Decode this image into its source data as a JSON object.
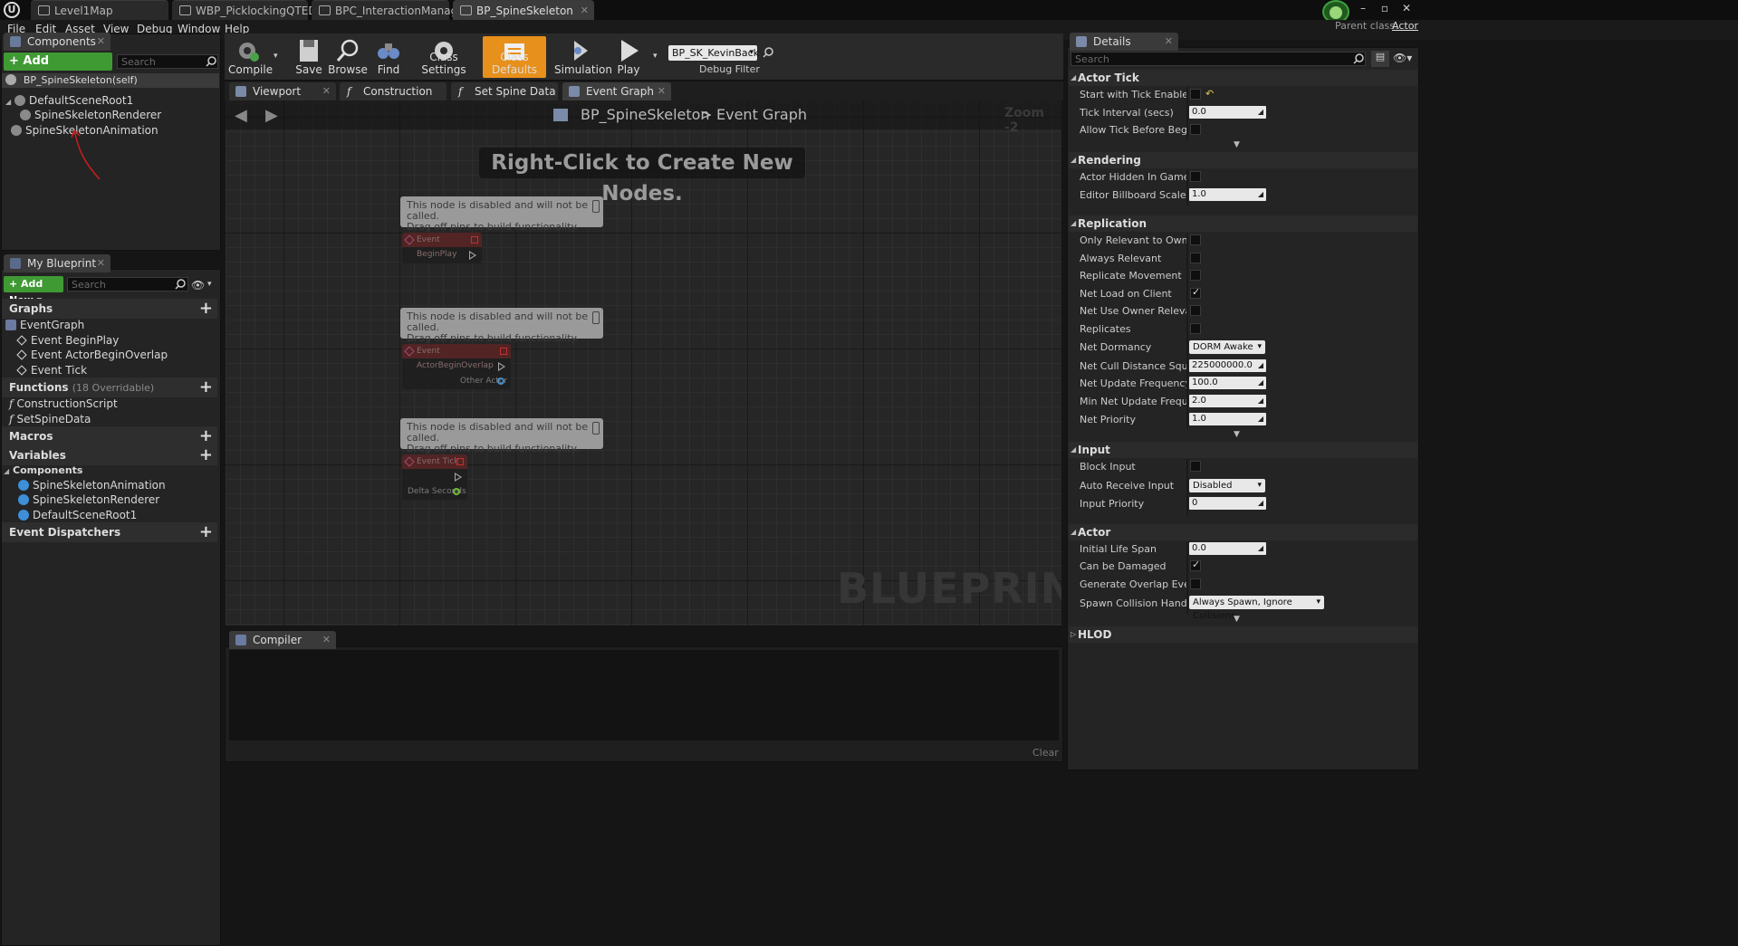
{
  "title_tabs": [
    "Level1Map",
    "WBP_PicklockingQTEDEV",
    "BPC_InteractionManager_",
    "BP_SpineSkeleton"
  ],
  "window_buttons": [
    "–",
    "▫",
    "✕"
  ],
  "parent_class": {
    "label": "Parent class:",
    "value": "Actor"
  },
  "menu": [
    "File",
    "Edit",
    "Asset",
    "View",
    "Debug",
    "Window",
    "Help"
  ],
  "components_panel": {
    "tab": "Components",
    "add_button": "+ Add Component ▾",
    "search_placeholder": "Search",
    "self_label": "BP_SpineSkeleton(self)",
    "tree": [
      "DefaultSceneRoot1",
      "SpineSkeletonRenderer",
      "SpineSkeletonAnimation"
    ]
  },
  "my_blueprint": {
    "tab": "My Blueprint",
    "add_button": "+ Add New ▾",
    "search_placeholder": "Search",
    "sections": {
      "graphs": "Graphs",
      "functions": "Functions",
      "functions_sub": "(18 Overridable)",
      "macros": "Macros",
      "variables": "Variables",
      "event_dispatchers": "Event Dispatchers"
    },
    "graph_items": [
      "EventGraph",
      "Event BeginPlay",
      "Event ActorBeginOverlap",
      "Event Tick"
    ],
    "function_items": [
      "ConstructionScript",
      "SetSpineData"
    ],
    "components_header": "Components",
    "component_vars": [
      "SpineSkeletonAnimation",
      "SpineSkeletonRenderer",
      "DefaultSceneRoot1"
    ]
  },
  "toolbar": {
    "compile": "Compile",
    "save": "Save",
    "browse": "Browse",
    "find": "Find",
    "class_settings": "Class Settings",
    "class_defaults": "Class Defaults",
    "simulation": "Simulation",
    "play": "Play",
    "debug_object": "BP_SK_KevinBack",
    "debug_filter": "Debug Filter"
  },
  "editor_tabs": [
    "Viewport",
    "Construction Scrip",
    "Set Spine Data",
    "Event Graph"
  ],
  "graph": {
    "breadcrumb_bp": "BP_SpineSkeleton",
    "breadcrumb_sep": ">",
    "breadcrumb_graph": "Event Graph",
    "zoom": "Zoom -2",
    "hint": "Right-Click to Create New Nodes.",
    "watermark": "BLUEPRINT",
    "disabled_line1": "This node is disabled and will not be called.",
    "disabled_line2": "Drag off pins to build functionality.",
    "nodes": [
      {
        "title": "Event BeginPlay"
      },
      {
        "title": "Event ActorBeginOverlap",
        "pin": "Other Actor"
      },
      {
        "title": "Event Tick",
        "pin": "Delta Seconds"
      }
    ]
  },
  "compiler": {
    "tab": "Compiler Results",
    "clear": "Clear"
  },
  "details": {
    "tab": "Details",
    "search_placeholder": "Search",
    "sections": {
      "actor_tick": "Actor Tick",
      "rendering": "Rendering",
      "replication": "Replication",
      "input": "Input",
      "actor": "Actor",
      "hlod": "HLOD"
    },
    "actor_tick": {
      "start_with_tick": "Start with Tick Enabled",
      "tick_interval": "Tick Interval (secs)",
      "tick_interval_value": "0.0",
      "allow_tick": "Allow Tick Before Begin Play"
    },
    "rendering": {
      "hidden": "Actor Hidden In Game",
      "billboard": "Editor Billboard Scale",
      "billboard_value": "1.0"
    },
    "replication": {
      "only_relevant": "Only Relevant to Owner",
      "always_relevant": "Always Relevant",
      "replicate_movement": "Replicate Movement",
      "net_load": "Net Load on Client",
      "net_use_owner": "Net Use Owner Relevancy",
      "replicates": "Replicates",
      "net_dormancy": "Net Dormancy",
      "net_dormancy_value": "DORM Awake",
      "net_cull": "Net Cull Distance Squared",
      "net_cull_value": "225000000.0",
      "net_update": "Net Update Frequency",
      "net_update_value": "100.0",
      "min_net_update": "Min Net Update Frequency",
      "min_net_update_value": "2.0",
      "net_priority": "Net Priority",
      "net_priority_value": "1.0"
    },
    "input": {
      "block_input": "Block Input",
      "auto_receive": "Auto Receive Input",
      "auto_receive_value": "Disabled",
      "input_priority": "Input Priority",
      "input_priority_value": "0"
    },
    "actor": {
      "initial_life": "Initial Life Span",
      "initial_life_value": "0.0",
      "can_be_damaged": "Can be Damaged",
      "gen_overlap": "Generate Overlap Events Dur",
      "spawn_collision": "Spawn Collision Handling Me",
      "spawn_collision_value": "Always Spawn, Ignore Collisions"
    }
  },
  "colors": {
    "accent_orange": "#e8901c",
    "green_button": "#3f9a34",
    "annotation_red": "#c81e1e"
  }
}
